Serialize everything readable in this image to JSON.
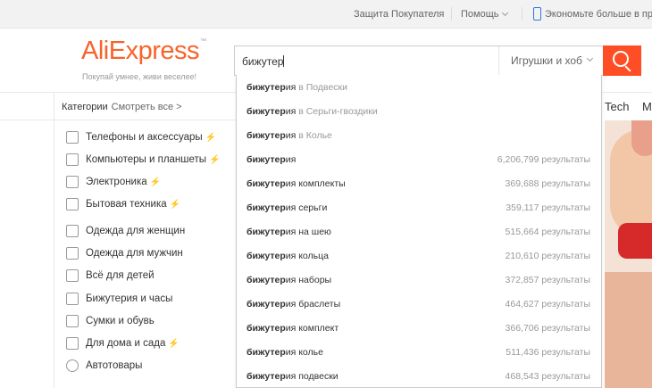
{
  "topbar": {
    "buyer_protection": "Защита Покупателя",
    "help": "Помощь",
    "app_promo": "Экономьте больше в при"
  },
  "header": {
    "logo": "AliExpress",
    "logo_tm": "™",
    "slogan": "Покупай умнее, живи веселее!"
  },
  "search": {
    "query": "бижутер",
    "category": "Игрушки и хоб"
  },
  "categories": {
    "title": "Категории",
    "see_all": "Смотреть все >",
    "items": [
      {
        "label": "Телефоны и аксессуары",
        "bolt": "⚡",
        "icon": "phone-icon"
      },
      {
        "label": "Компьютеры и планшеты",
        "bolt": "⚡",
        "icon": "laptop-icon"
      },
      {
        "label": "Электроника",
        "bolt": "⚡",
        "icon": "tv-icon"
      },
      {
        "label": "Бытовая техника",
        "bolt": "⚡",
        "icon": "appliance-icon"
      },
      {
        "label": "Одежда для женщин",
        "bolt": "",
        "icon": "dress-icon"
      },
      {
        "label": "Одежда для мужчин",
        "bolt": "",
        "icon": "shirt-icon"
      },
      {
        "label": "Всё для детей",
        "bolt": "",
        "icon": "baby-bottle-icon"
      },
      {
        "label": "Бижутерия и часы",
        "bolt": "",
        "icon": "jewelry-icon"
      },
      {
        "label": "Сумки и обувь",
        "bolt": "",
        "icon": "bag-icon"
      },
      {
        "label": "Для дома и сада",
        "bolt": "⚡",
        "icon": "sofa-icon"
      },
      {
        "label": "Автотовары",
        "bolt": "",
        "icon": "wheel-icon"
      }
    ]
  },
  "nav_right": {
    "tech": "Tech",
    "m": "M"
  },
  "suggestions": [
    {
      "bold": "бижутер",
      "rest": "ия",
      "cat": " в Подвески",
      "count": ""
    },
    {
      "bold": "бижутер",
      "rest": "ия",
      "cat": " в Серьги-гвоздики",
      "count": ""
    },
    {
      "bold": "бижутер",
      "rest": "ия",
      "cat": " в Колье",
      "count": ""
    },
    {
      "bold": "бижутер",
      "rest": "ия",
      "cat": "",
      "count": "6,206,799 результаты"
    },
    {
      "bold": "бижутер",
      "rest": "ия комплекты",
      "cat": "",
      "count": "369,688 результаты"
    },
    {
      "bold": "бижутер",
      "rest": "ия серьги",
      "cat": "",
      "count": "359,117 результаты"
    },
    {
      "bold": "бижутер",
      "rest": "ия на шею",
      "cat": "",
      "count": "515,664 результаты"
    },
    {
      "bold": "бижутер",
      "rest": "ия кольца",
      "cat": "",
      "count": "210,610 результаты"
    },
    {
      "bold": "бижутер",
      "rest": "ия наборы",
      "cat": "",
      "count": "372,857 результаты"
    },
    {
      "bold": "бижутер",
      "rest": "ия браслеты",
      "cat": "",
      "count": "464,627 результаты"
    },
    {
      "bold": "бижутер",
      "rest": "ия комплект",
      "cat": "",
      "count": "366,706 результаты"
    },
    {
      "bold": "бижутер",
      "rest": "ия колье",
      "cat": "",
      "count": "511,436 результаты"
    },
    {
      "bold": "бижутер",
      "rest": "ия подвески",
      "cat": "",
      "count": "468,543 результаты"
    }
  ]
}
